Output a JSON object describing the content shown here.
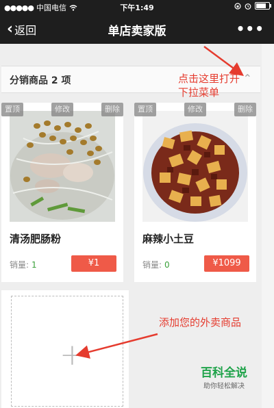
{
  "status_bar": {
    "signal": "●●●●●",
    "carrier": "中国电信",
    "time": "下午1:49",
    "battery_level": 0.8
  },
  "nav": {
    "back_label": "返回",
    "title": "单店卖家版",
    "more_label": "•••"
  },
  "dropdown": {
    "label": "分销商品 2 项",
    "arrow": "⌃"
  },
  "toolbar_labels": [
    "置顶",
    "修改",
    "删除"
  ],
  "products": [
    {
      "name": "清汤肥肠粉",
      "sales_label": "销量:",
      "sales": "1",
      "price": "¥1"
    },
    {
      "name": "麻辣小土豆",
      "sales_label": "销量:",
      "sales": "0",
      "price": "¥1099"
    }
  ],
  "add_card": {
    "plus": "+"
  },
  "annotations": {
    "line1": "点击这里打开",
    "line2": "下拉菜单",
    "add_hint": "添加您的外卖商品"
  },
  "watermark": {
    "title": "百科全说",
    "subtitle": "助你轻松解决"
  },
  "colors": {
    "price_bg": "#ef5a48",
    "sales": "#3aa03a",
    "annotation": "#e53b2e"
  }
}
